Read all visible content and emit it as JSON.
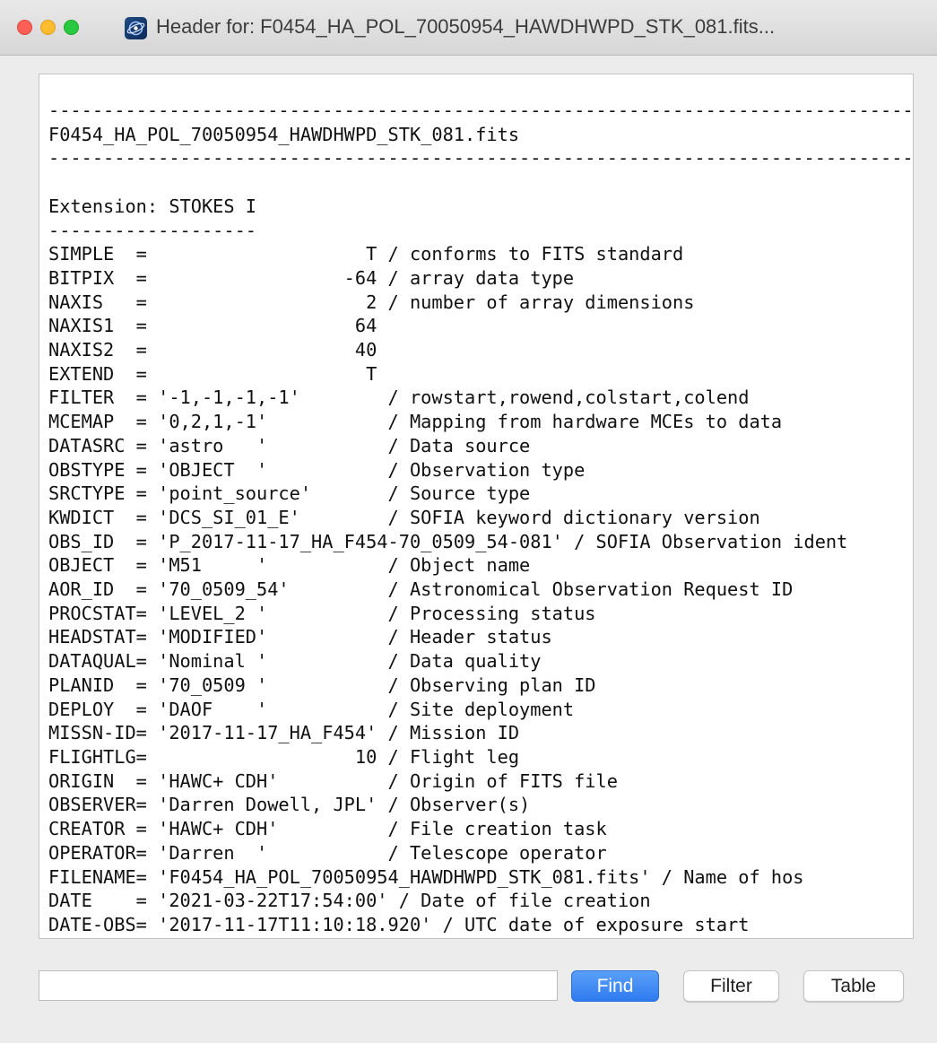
{
  "window": {
    "title": "Header for: F0454_HA_POL_70050954_HAWDHWPD_STK_081.fits..."
  },
  "header_lines": [
    "--------------------------------------------------------------------------------",
    "F0454_HA_POL_70050954_HAWDHWPD_STK_081.fits",
    "--------------------------------------------------------------------------------",
    "",
    "Extension: STOKES I",
    "-------------------",
    "SIMPLE  =                    T / conforms to FITS standard",
    "BITPIX  =                  -64 / array data type",
    "NAXIS   =                    2 / number of array dimensions",
    "NAXIS1  =                   64",
    "NAXIS2  =                   40",
    "EXTEND  =                    T",
    "FILTER  = '-1,-1,-1,-1'        / rowstart,rowend,colstart,colend",
    "MCEMAP  = '0,2,1,-1'           / Mapping from hardware MCEs to data",
    "DATASRC = 'astro   '           / Data source",
    "OBSTYPE = 'OBJECT  '           / Observation type",
    "SRCTYPE = 'point_source'       / Source type",
    "KWDICT  = 'DCS_SI_01_E'        / SOFIA keyword dictionary version",
    "OBS_ID  = 'P_2017-11-17_HA_F454-70_0509_54-081' / SOFIA Observation ident",
    "OBJECT  = 'M51     '           / Object name",
    "AOR_ID  = '70_0509_54'         / Astronomical Observation Request ID",
    "PROCSTAT= 'LEVEL_2 '           / Processing status",
    "HEADSTAT= 'MODIFIED'           / Header status",
    "DATAQUAL= 'Nominal '           / Data quality",
    "PLANID  = '70_0509 '           / Observing plan ID",
    "DEPLOY  = 'DAOF    '           / Site deployment",
    "MISSN-ID= '2017-11-17_HA_F454' / Mission ID",
    "FLIGHTLG=                   10 / Flight leg",
    "ORIGIN  = 'HAWC+ CDH'          / Origin of FITS file",
    "OBSERVER= 'Darren Dowell, JPL' / Observer(s)",
    "CREATOR = 'HAWC+ CDH'          / File creation task",
    "OPERATOR= 'Darren  '           / Telescope operator",
    "FILENAME= 'F0454_HA_POL_70050954_HAWDHWPD_STK_081.fits' / Name of hos",
    "DATE    = '2021-03-22T17:54:00' / Date of file creation",
    "DATE-OBS= '2017-11-17T11:10:18.920' / UTC date of exposure start"
  ],
  "search": {
    "value": "",
    "placeholder": ""
  },
  "buttons": {
    "find": "Find",
    "filter": "Filter",
    "table": "Table"
  }
}
